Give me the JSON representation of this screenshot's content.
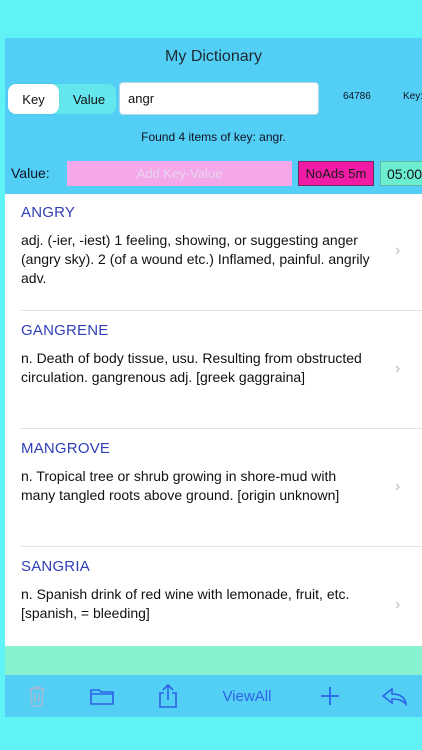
{
  "app": {
    "title": "My Dictionary"
  },
  "segmented": {
    "key_label": "Key",
    "value_label": "Value"
  },
  "search": {
    "value": "angr",
    "count": "64786",
    "key_label": "Key:"
  },
  "found_text": "Found 4 items of key: angr.",
  "value_row": {
    "label": "Value:",
    "add_placeholder": "Add Key-Value",
    "noads_label": "NoAds 5m",
    "timer": "05:00"
  },
  "results": [
    {
      "word": "ANGRY",
      "definition": "adj. (-ier, -iest) 1 feeling, showing, or suggesting anger (angry sky). 2 (of a wound etc.) Inflamed, painful.  angrily adv."
    },
    {
      "word": "GANGRENE",
      "definition": "n. Death of body tissue, usu. Resulting from obstructed circulation.  gangrenous adj. [greek gaggraina]"
    },
    {
      "word": "MANGROVE",
      "definition": "n. Tropical tree or shrub growing in shore-mud with many tangled roots above ground. [origin unknown]"
    },
    {
      "word": "SANGRIA",
      "definition": "n. Spanish drink of red wine with lemonade, fruit, etc. [spanish, = bleeding]"
    }
  ],
  "toolbar": {
    "view_all": "ViewAll"
  },
  "colors": {
    "accent": "#2d63e5",
    "word": "#2f3fb6",
    "header": "#53CFF5",
    "noads": "#F21BA5",
    "add": "#F5A8E9",
    "mint": "#86F2CF"
  }
}
